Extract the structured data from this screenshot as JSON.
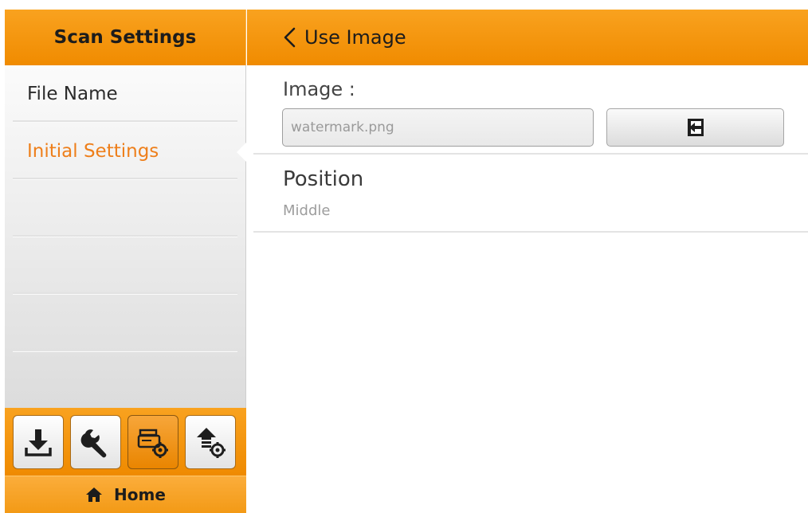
{
  "header": {
    "left_title": "Scan Settings",
    "back_label": "Use Image"
  },
  "sidebar": {
    "items": [
      {
        "label": "File Name",
        "active": false
      },
      {
        "label": "Initial Settings",
        "active": true
      }
    ]
  },
  "toolbar": {
    "buttons": [
      {
        "icon": "download-icon",
        "selected": false
      },
      {
        "icon": "wrench-icon",
        "selected": false
      },
      {
        "icon": "scanner-settings-icon",
        "selected": true
      },
      {
        "icon": "upload-settings-icon",
        "selected": false
      }
    ]
  },
  "footer": {
    "home_label": "Home",
    "home_icon": "home-icon"
  },
  "main": {
    "image_label": "Image :",
    "image_value": "watermark.png",
    "import_icon": "import-icon",
    "position_title": "Position",
    "position_value": "Middle"
  },
  "colors": {
    "accent": "#f39a16",
    "active_text": "#ee7f1b"
  }
}
